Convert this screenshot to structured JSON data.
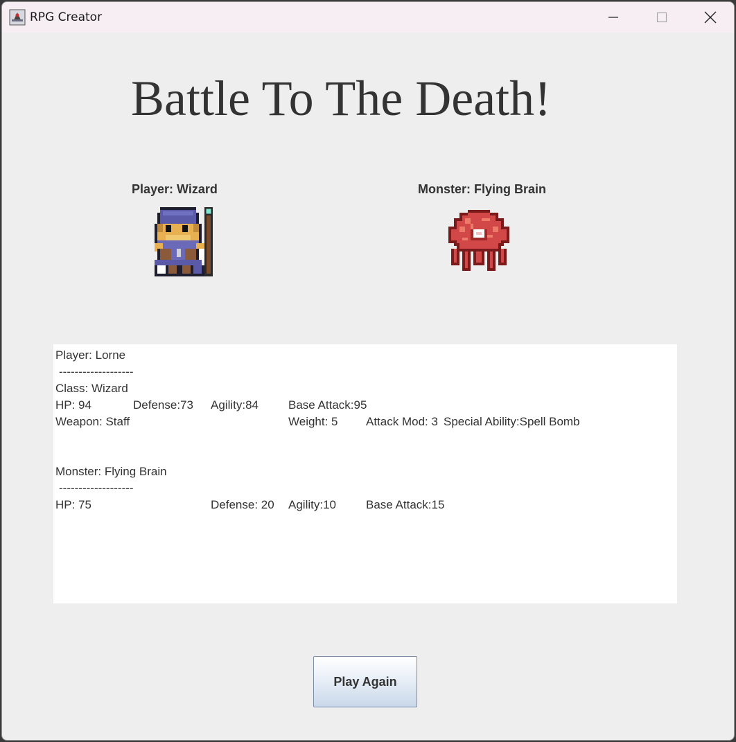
{
  "window": {
    "title": "RPG Creator"
  },
  "heading": "Battle To The Death!",
  "player_label": "Player: Wizard",
  "monster_label": "Monster: Flying Brain",
  "stats": {
    "player_name": "Player: Lorne",
    "divider1": "-------------------",
    "class": "Class: Wizard",
    "hp": "HP: 94",
    "defense": "Defense:73",
    "agility": "Agility:84",
    "base_attack": "Base Attack:95",
    "weapon": "Weapon: Staff",
    "weight": "Weight: 5",
    "attack_mod": "Attack Mod: 3",
    "special": "Special Ability:Spell Bomb",
    "monster_name": "Monster: Flying Brain",
    "divider2": "-------------------",
    "m_hp": "HP: 75",
    "m_defense": "Defense: 20",
    "m_agility": "Agility:10",
    "m_base_attack": "Base Attack:15"
  },
  "buttons": {
    "play_again": "Play Again"
  },
  "icons": {
    "app": "rpg-app-icon",
    "minimize": "minimize-icon",
    "maximize": "maximize-icon",
    "close": "close-icon",
    "player_sprite": "wizard-sprite",
    "monster_sprite": "flying-brain-sprite"
  },
  "colors": {
    "titlebar": "#f6eef3",
    "background": "#eeeeee",
    "panel": "#ffffff",
    "text": "#333333"
  }
}
